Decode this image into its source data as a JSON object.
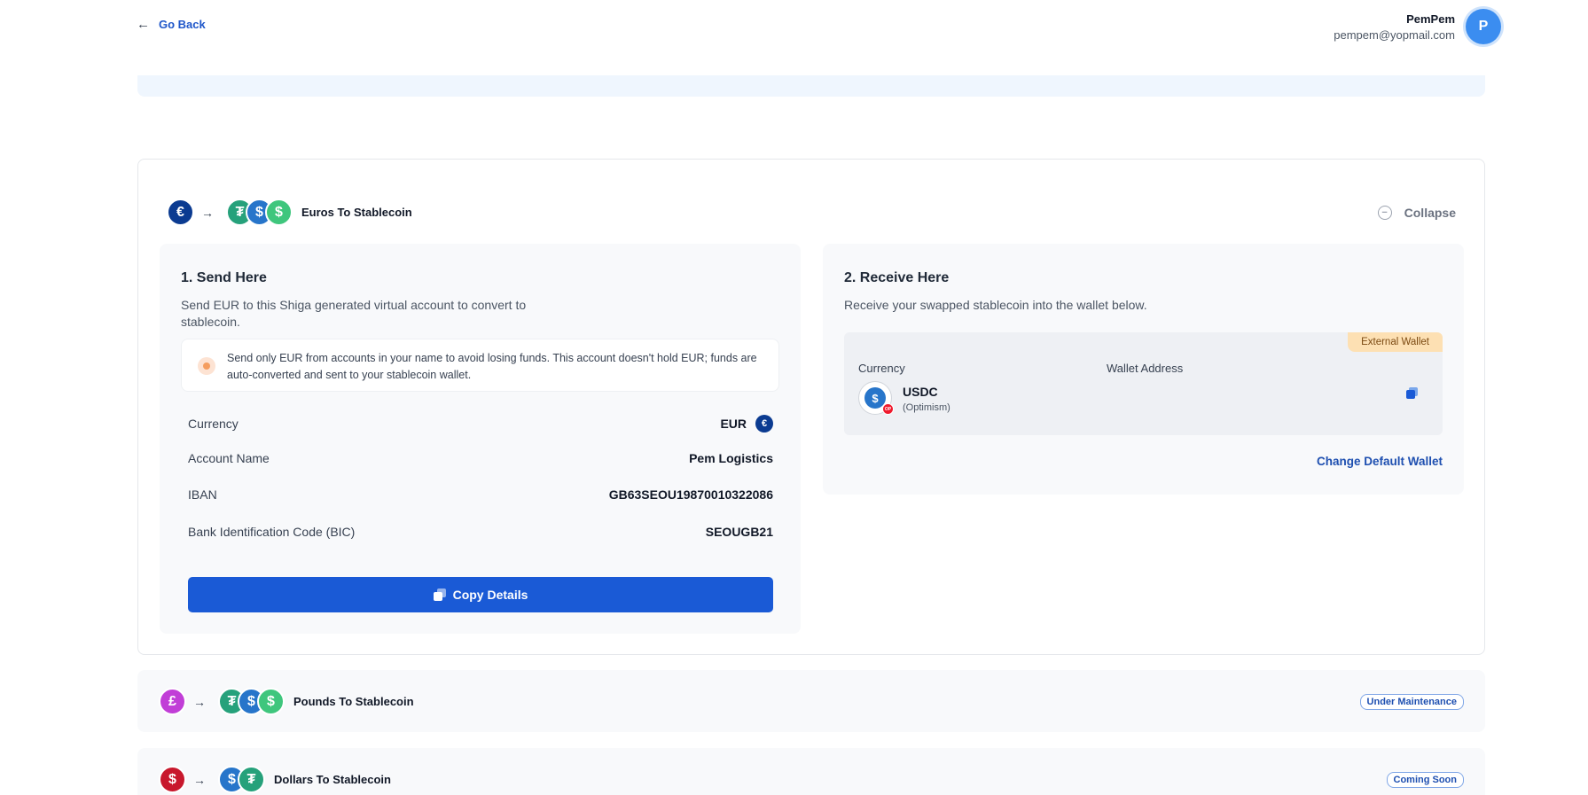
{
  "header": {
    "back_label": "Go Back",
    "user_name": "PemPem",
    "user_email": "pempem@yopmail.com",
    "avatar_initial": "P"
  },
  "main_card": {
    "title": "Euros To Stablecoin",
    "collapse_label": "Collapse",
    "send": {
      "heading": "1. Send Here",
      "description": "Send EUR to this Shiga generated virtual account to convert to stablecoin.",
      "notice": "Send only EUR from accounts in your name to avoid losing funds. This account doesn't hold EUR; funds are auto-converted and sent to your stablecoin wallet.",
      "rows": [
        {
          "label": "Currency",
          "value": "EUR"
        },
        {
          "label": "Account Name",
          "value": "Pem Logistics"
        },
        {
          "label": "IBAN",
          "value": "GB63SEOU19870010322086"
        },
        {
          "label": "Bank Identification Code (BIC)",
          "value": "SEOUGB21"
        }
      ],
      "copy_button": "Copy Details"
    },
    "receive": {
      "heading": "2. Receive Here",
      "description": "Receive your swapped stablecoin into the wallet below.",
      "tag": "External Wallet",
      "currency_label": "Currency",
      "wallet_label": "Wallet Address",
      "coin": "USDC",
      "network": "(Optimism)",
      "change_wallet": "Change Default Wallet"
    }
  },
  "other_cards": [
    {
      "title": "Pounds To Stablecoin",
      "status": "Under Maintenance"
    },
    {
      "title": "Dollars To Stablecoin",
      "status": "Coming Soon"
    }
  ],
  "icons": {
    "eur": "€",
    "gbp": "£",
    "usd": "$",
    "usdt": "₮",
    "usdc": "$",
    "gusd": "$"
  },
  "colors": {
    "primary": "#1a5ad6",
    "eur": "#0b3b91",
    "gbp": "#c13ed7",
    "usd": "#c8182d",
    "usdt": "#26a17b",
    "usdc": "#2775ca",
    "warning_tag": "#fde0b3"
  }
}
